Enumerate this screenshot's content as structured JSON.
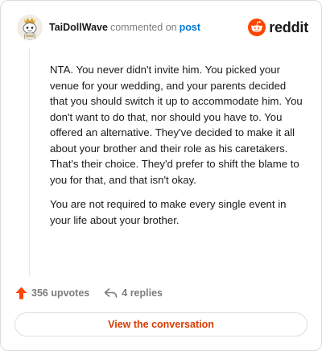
{
  "comment": {
    "username": "TaiDollWave",
    "action_text": "commented on",
    "link_text": "post",
    "paragraphs": [
      "NTA. You never didn't invite him. You picked your venue for your wedding, and your parents decided that you should switch it up to accommodate him. You don't want to do that, nor should you have to. You offered an alternative. They've decided to make it all about your brother and their role as his caretakers. That's their choice. They'd prefer to shift the blame to you for that, and that isn't okay.",
      "You are not required to make every single event in your life about your brother."
    ],
    "upvotes_label": "356 upvotes",
    "replies_label": "4 replies"
  },
  "brand": {
    "name": "reddit",
    "icon": "reddit-snoo-icon",
    "color": "#ff4500"
  },
  "footer": {
    "button_label": "View the conversation",
    "accent_color": "#d93a00"
  },
  "icons": {
    "avatar": "snoo-avatar-icon",
    "upvote": "upvote-arrow-icon",
    "reply": "reply-arrow-icon"
  }
}
